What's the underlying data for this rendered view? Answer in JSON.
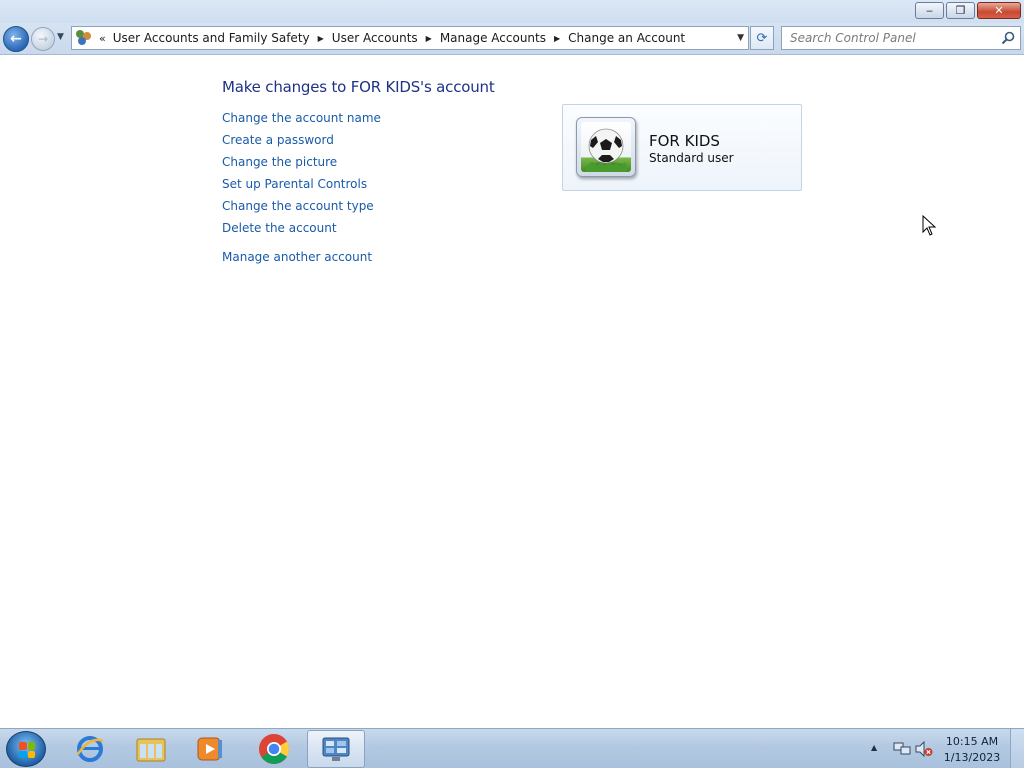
{
  "window": {
    "minimize_glyph": "‒",
    "maximize_glyph": "❐",
    "close_glyph": "✕"
  },
  "nav": {
    "back_glyph": "←",
    "forward_glyph": "→",
    "recent_glyph": "▼",
    "chevron": "«",
    "breadcrumbs": [
      "User Accounts and Family Safety",
      "User Accounts",
      "Manage Accounts",
      "Change an Account"
    ],
    "separator_glyph": "▶",
    "dropdown_glyph": "▼",
    "refresh_glyph": "⟳",
    "search_placeholder": "Search Control Panel"
  },
  "main": {
    "heading": "Make changes to FOR KIDS's account",
    "tasks": [
      "Change the account name",
      "Create a password",
      "Change the picture",
      "Set up Parental Controls",
      "Change the account type",
      "Delete the account",
      "Manage another account"
    ]
  },
  "account": {
    "name": "FOR KIDS",
    "type": "Standard user",
    "picture_icon": "soccer-ball-icon"
  },
  "taskbar": {
    "pinned": [
      {
        "name": "internet-explorer-icon"
      },
      {
        "name": "windows-explorer-icon"
      },
      {
        "name": "media-player-icon"
      },
      {
        "name": "chrome-icon"
      },
      {
        "name": "control-panel-icon",
        "active": true
      }
    ],
    "tray_arrow": "▲",
    "time": "10:15 AM",
    "date": "1/13/2023"
  },
  "colors": {
    "link": "#1a5aa8",
    "heading": "#1e3287",
    "close_button": "#c74a32",
    "taskbar": "#b3c9e2"
  }
}
